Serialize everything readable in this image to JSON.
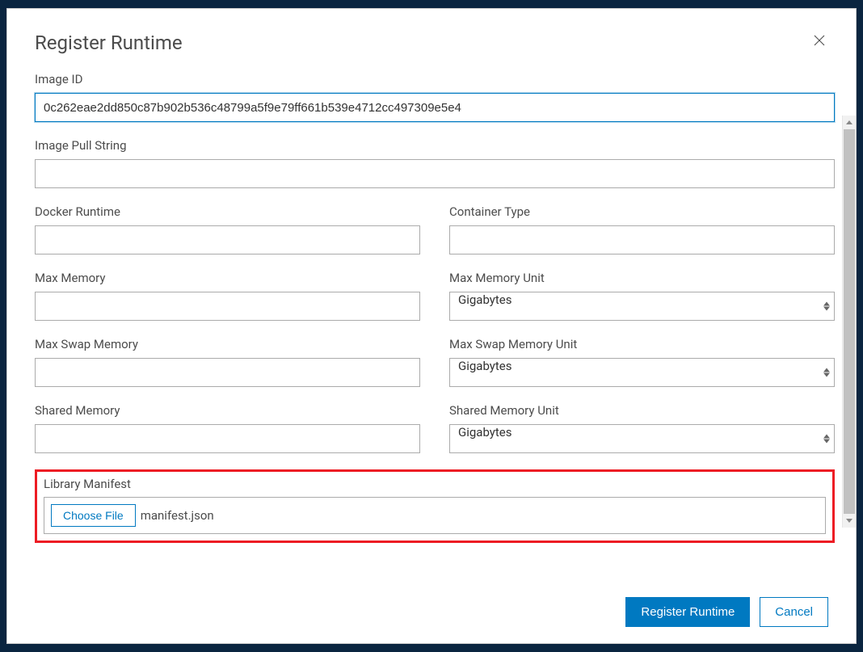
{
  "modal": {
    "title": "Register Runtime"
  },
  "fields": {
    "imageId": {
      "label": "Image ID",
      "value": "0c262eae2dd850c87b902b536c48799a5f9e79ff661b539e4712cc497309e5e4"
    },
    "imagePullString": {
      "label": "Image Pull String",
      "value": ""
    },
    "dockerRuntime": {
      "label": "Docker Runtime",
      "value": ""
    },
    "containerType": {
      "label": "Container Type",
      "value": ""
    },
    "maxMemory": {
      "label": "Max Memory",
      "value": ""
    },
    "maxMemoryUnit": {
      "label": "Max Memory Unit",
      "selected": "Gigabytes"
    },
    "maxSwapMemory": {
      "label": "Max Swap Memory",
      "value": ""
    },
    "maxSwapMemoryUnit": {
      "label": "Max Swap Memory Unit",
      "selected": "Gigabytes"
    },
    "sharedMemory": {
      "label": "Shared Memory",
      "value": ""
    },
    "sharedMemoryUnit": {
      "label": "Shared Memory Unit",
      "selected": "Gigabytes"
    },
    "libraryManifest": {
      "label": "Library Manifest",
      "chooseFileLabel": "Choose File",
      "fileName": "manifest.json"
    }
  },
  "footer": {
    "submitLabel": "Register Runtime",
    "cancelLabel": "Cancel"
  }
}
